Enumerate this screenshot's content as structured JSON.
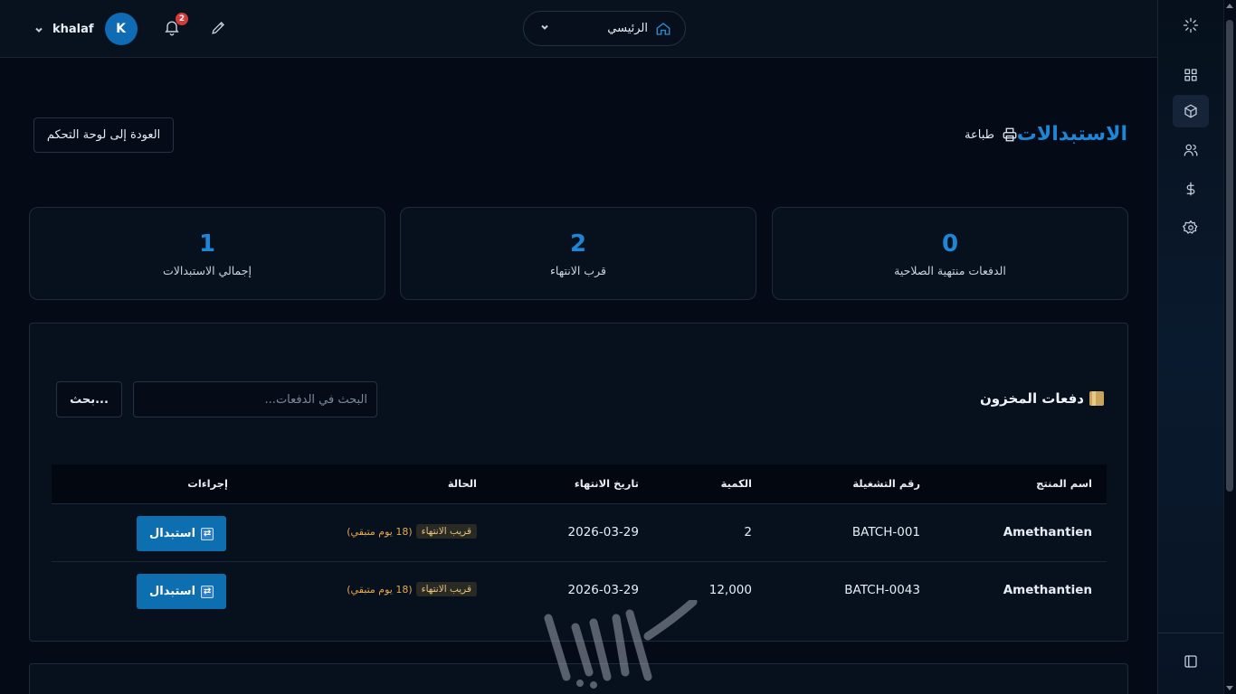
{
  "topbar": {
    "user_name": "khalaf",
    "avatar_initial": "K",
    "notification_count": "2",
    "home_label": "الرئيسي"
  },
  "page": {
    "title": "الاستبدالات",
    "print_label": "طباعة",
    "back_button": "العودة إلى لوحة التحكم"
  },
  "stats": [
    {
      "value": "0",
      "label": "الدفعات منتهية الصلاحية"
    },
    {
      "value": "2",
      "label": "قرب الانتهاء"
    },
    {
      "value": "1",
      "label": "إجمالي الاستبدالات"
    }
  ],
  "batches": {
    "title": "دفعات المخزون",
    "search_placeholder": "البحث في الدفعات...",
    "search_button": "بحث...",
    "columns": {
      "product": "اسم المنتج",
      "batch": "رقم التشغيلة",
      "qty": "الكمية",
      "expiry": "تاريخ الانتهاء",
      "status": "الحالة",
      "actions": "إجراءات"
    },
    "rows": [
      {
        "product": "Amethantien",
        "batch": "BATCH-001",
        "qty": "2",
        "expiry": "2026-03-29",
        "status": "قريب الانتهاء",
        "days": "(18 يوم متبقي)",
        "action": "استبدال"
      },
      {
        "product": "Amethantien",
        "batch": "BATCH-0043",
        "qty": "12,000",
        "expiry": "2026-03-29",
        "status": "قريب الانتهاء",
        "days": "(18 يوم متبقي)",
        "action": "استبدال"
      }
    ]
  },
  "sidebar": {
    "icons": [
      "logo-icon",
      "dashboard-icon",
      "box-icon",
      "users-icon",
      "dollar-icon",
      "settings-icon",
      "sidebar-toggle-icon"
    ]
  },
  "colors": {
    "accent": "#1e86d6",
    "button": "#0d6eb0",
    "background": "#040b16",
    "badge_text": "#e6c27a"
  }
}
